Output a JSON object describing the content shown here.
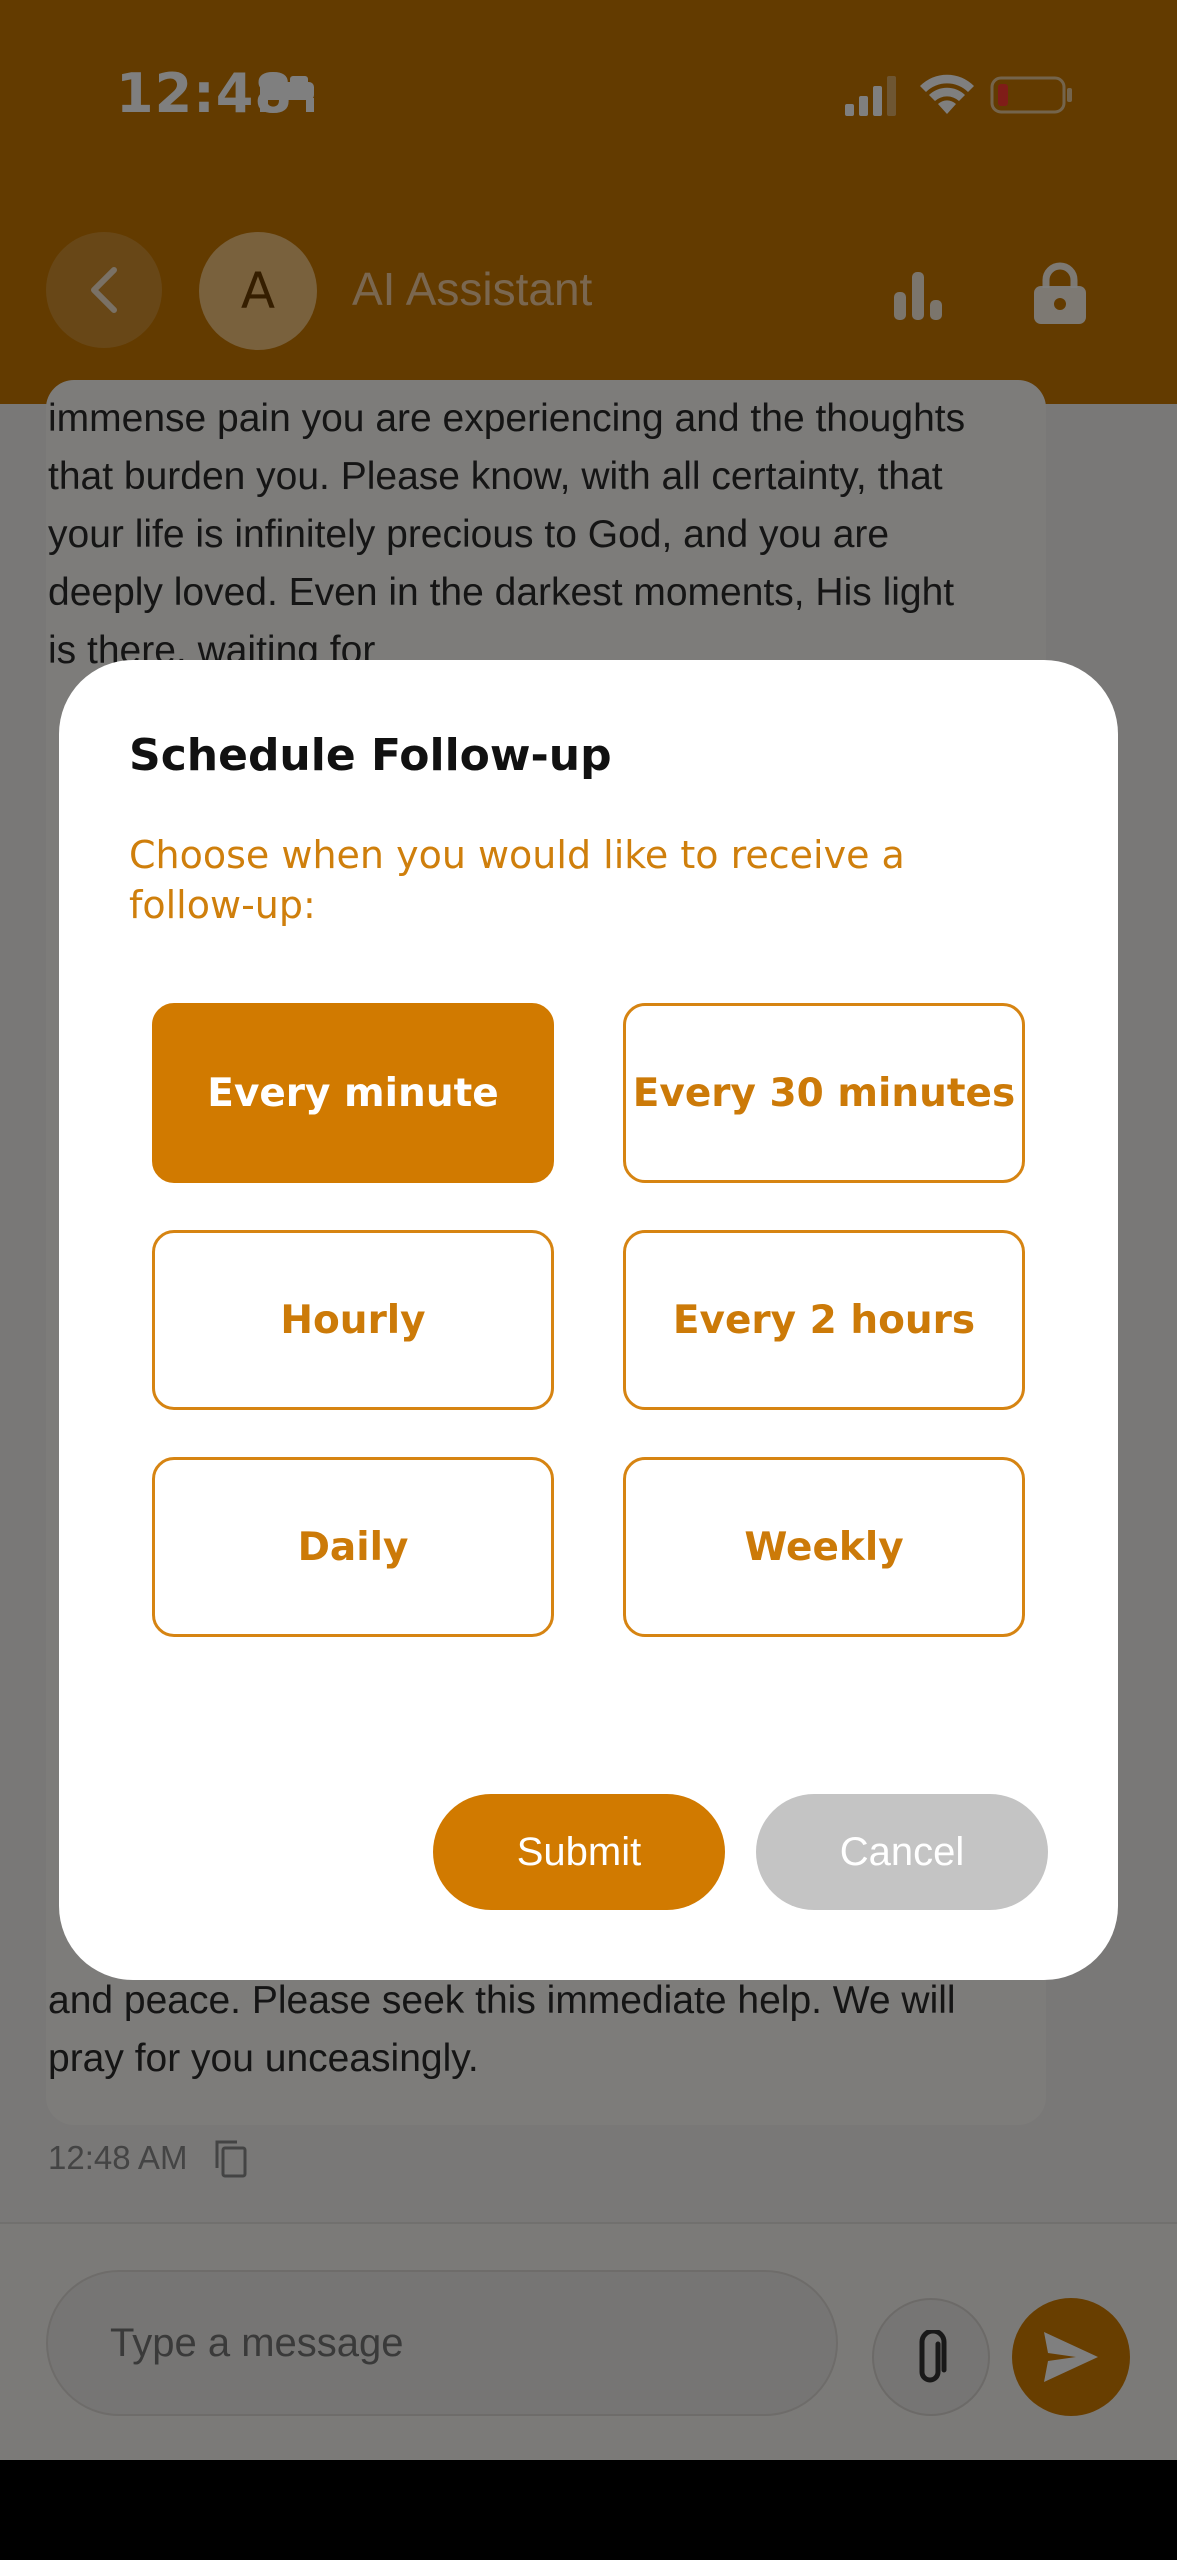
{
  "status_bar": {
    "time": "12:48",
    "icons": [
      "bed-icon",
      "signal-icon",
      "wifi-icon",
      "battery-low-icon"
    ]
  },
  "header": {
    "avatar_letter": "A",
    "title": "AI Assistant",
    "icons": [
      "chevron-left-icon",
      "bar-chart-icon",
      "lock-icon"
    ]
  },
  "chat": {
    "message_top": "immense pain you are experiencing and the thoughts that burden you. Please know, with all certainty, that your life is infinitely precious to God, and you are deeply loved. Even in the darkest moments, His light is there, waiting for",
    "message_bottom": "and peace. Please seek this immediate help. We will pray for you unceasingly.",
    "timestamp": "12:48 AM"
  },
  "input": {
    "placeholder": "Type a message"
  },
  "modal": {
    "title": "Schedule Follow-up",
    "subtitle": "Choose when you would like to receive a follow-up:",
    "options": [
      {
        "label": "Every minute",
        "selected": true
      },
      {
        "label": "Every 30 minutes",
        "selected": false
      },
      {
        "label": "Hourly",
        "selected": false
      },
      {
        "label": "Every 2 hours",
        "selected": false
      },
      {
        "label": "Daily",
        "selected": false
      },
      {
        "label": "Weekly",
        "selected": false
      }
    ],
    "submit_label": "Submit",
    "cancel_label": "Cancel"
  },
  "colors": {
    "accent": "#d17a00",
    "header": "#c77700",
    "cancel": "#c4c4c4"
  }
}
